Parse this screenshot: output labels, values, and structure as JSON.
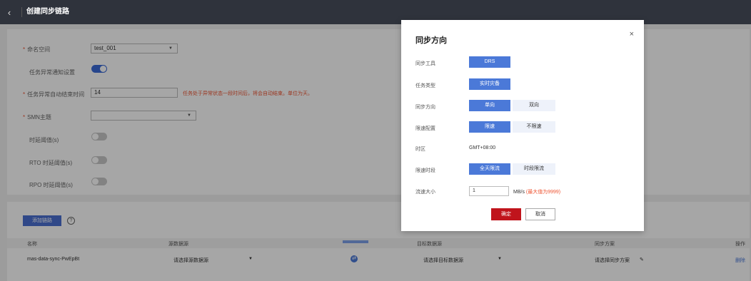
{
  "topbar": {
    "back_icon": "chevron-left-icon",
    "title": "创建同步链路"
  },
  "form": {
    "namespace_label": "命名空间",
    "namespace_value": "test_001",
    "notify_label": "任务异常通知设置",
    "autoend_label": "任务异常自动结束时间",
    "autoend_value": "14",
    "autoend_hint": "任务处于异常状态一段时间后，将会自动结束。单位为天。",
    "smn_label": "SMN主题",
    "smn_value": "",
    "delay_label": "时延阈值(s)",
    "rto_label": "RTO 时延阈值(s)",
    "rpo_label": "RPO 时延阈值(s)",
    "required_mark": "*"
  },
  "links": {
    "add_button": "添加链路",
    "help_icon": "?",
    "headers": {
      "name": "名称",
      "source": "源数据源",
      "target": "目标数据源",
      "plan": "同步方案",
      "action": "操作"
    },
    "row": {
      "name": "mas-data-sync-PwEpBt",
      "source": "请选择源数据源",
      "target": "请选择目标数据源",
      "plan": "请选择同步方案",
      "action": "删除"
    }
  },
  "modal": {
    "title": "同步方向",
    "close": "×",
    "tool_label": "同步工具",
    "tool_value": "DRS",
    "type_label": "任务类型",
    "type_value": "实时灾备",
    "direction_label": "同步方向",
    "direction_options": [
      "单向",
      "双向"
    ],
    "direction_selected": "单向",
    "limit_label": "限速配置",
    "limit_options": [
      "限速",
      "不限速"
    ],
    "limit_selected": "限速",
    "tz_label": "时区",
    "tz_value": "GMT+08:00",
    "period_label": "限速时段",
    "period_options": [
      "全天限流",
      "时段限流"
    ],
    "period_selected": "全天限流",
    "flow_label": "流速大小",
    "flow_value": "1",
    "flow_unit": "MB/s",
    "flow_max": "(最大值为9999)",
    "ok": "确定",
    "cancel": "取消"
  },
  "colors": {
    "accent": "#4b79d8",
    "danger": "#c0141c",
    "topbar": "#2f333c"
  }
}
